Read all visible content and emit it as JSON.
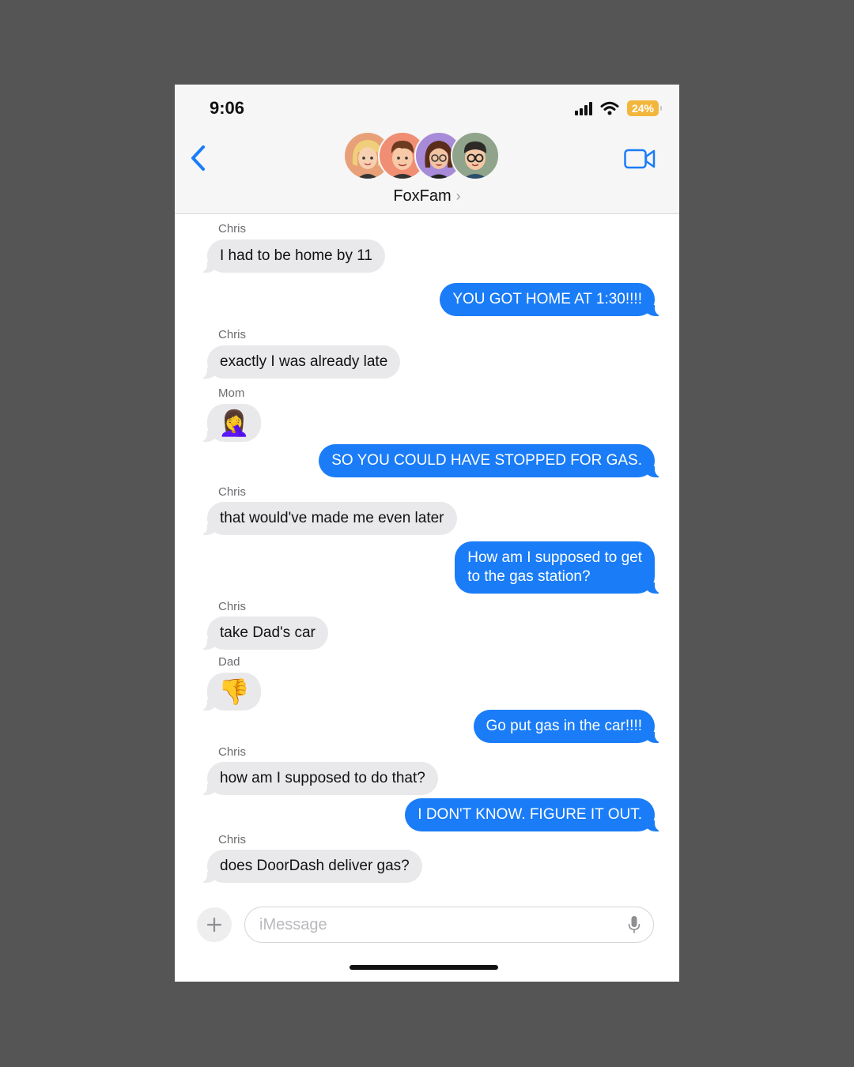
{
  "status_bar": {
    "time": "9:06",
    "battery": "24%"
  },
  "header": {
    "group_name": "FoxFam",
    "avatars": [
      "avatar-blonde-woman",
      "avatar-brown-hair-man",
      "avatar-woman-glasses",
      "avatar-man-glasses"
    ]
  },
  "messages": [
    {
      "sender": "Chris",
      "text": "I had to be home by 11",
      "direction": "incoming"
    },
    {
      "sender": "",
      "text": "YOU GOT HOME AT 1:30!!!!",
      "direction": "outgoing"
    },
    {
      "sender": "Chris",
      "text": "exactly I was already late",
      "direction": "incoming"
    },
    {
      "sender": "Mom",
      "text": "🤦‍♀️",
      "direction": "incoming",
      "emoji": "woman-facepalming"
    },
    {
      "sender": "",
      "text": "SO YOU COULD HAVE STOPPED FOR GAS.",
      "direction": "outgoing"
    },
    {
      "sender": "Chris",
      "text": "that would've made me even later",
      "direction": "incoming"
    },
    {
      "sender": "",
      "lines": [
        "How am I supposed to get",
        "to the gas station?"
      ],
      "direction": "outgoing"
    },
    {
      "sender": "Chris",
      "text": "take Dad's car",
      "direction": "incoming"
    },
    {
      "sender": "Dad",
      "text": "👎",
      "direction": "incoming",
      "emoji": "thumbs-down"
    },
    {
      "sender": "",
      "text": "Go put gas in the car!!!!",
      "direction": "outgoing"
    },
    {
      "sender": "Chris",
      "text": "how am I supposed to do that?",
      "direction": "incoming"
    },
    {
      "sender": "",
      "text": "I DON'T KNOW. FIGURE IT OUT.",
      "direction": "outgoing"
    },
    {
      "sender": "Chris",
      "text": "does DoorDash deliver gas?",
      "direction": "incoming"
    }
  ],
  "composer": {
    "placeholder": "iMessage"
  },
  "colors": {
    "outgoing_bubble": "#1a7cf7",
    "incoming_bubble": "#e9e9eb",
    "accent": "#1a7cf7",
    "battery": "#f2b63c"
  }
}
